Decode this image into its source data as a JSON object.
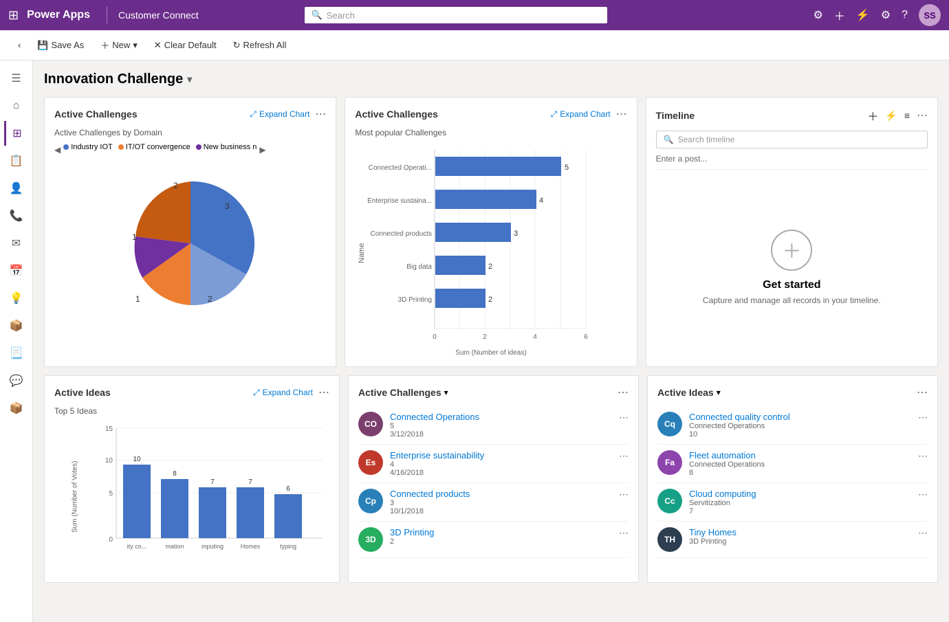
{
  "topNav": {
    "brand": "Power Apps",
    "divider": "|",
    "appName": "Customer Connect",
    "searchPlaceholder": "Search",
    "avatar": "SS"
  },
  "toolbar": {
    "saveAs": "Save As",
    "new": "New",
    "clearDefault": "Clear Default",
    "refreshAll": "Refresh All"
  },
  "pageTitle": "Innovation Challenge",
  "sidebar": {
    "items": [
      "⊞",
      "⌂",
      "☰",
      "♟",
      "👤",
      "☎",
      "✉",
      "📅",
      "💡",
      "📦",
      "🗂",
      "💬",
      "📦"
    ]
  },
  "topRow": {
    "activeChallengesChart1": {
      "title": "Active Challenges",
      "expandLabel": "Expand Chart",
      "chartSubtitle": "Active Challenges by Domain",
      "legend": [
        {
          "label": "Industry IOT",
          "color": "#4472c4"
        },
        {
          "label": "IT/OT convergence",
          "color": "#ed7d31"
        },
        {
          "label": "New business n",
          "color": "#7030a0"
        }
      ],
      "pieData": [
        {
          "label": "1",
          "value": 1,
          "color": "#ed7d31"
        },
        {
          "label": "2",
          "value": 2,
          "color": "#4472c4"
        },
        {
          "label": "3",
          "value": 3,
          "color": "#4472c4"
        },
        {
          "label": "1",
          "value": 1,
          "color": "#7030a0"
        },
        {
          "label": "2",
          "value": 2,
          "color": "#c55a11"
        }
      ]
    },
    "activeChallengesChart2": {
      "title": "Active Challenges",
      "expandLabel": "Expand Chart",
      "chartSubtitle": "Most popular Challenges",
      "yAxisLabel": "Name",
      "xAxisLabel": "Sum (Number of ideas)",
      "bars": [
        {
          "label": "Connected Operati...",
          "value": 5
        },
        {
          "label": "Enterprise sustaina...",
          "value": 4
        },
        {
          "label": "Connected products",
          "value": 3
        },
        {
          "label": "Big data",
          "value": 2
        },
        {
          "label": "3D Printing",
          "value": 2
        }
      ],
      "xMax": 6
    },
    "timeline": {
      "title": "Timeline",
      "searchPlaceholder": "Search timeline",
      "enterPost": "Enter a post...",
      "getStarted": "Get started",
      "getStartedSub": "Capture and manage all records in your timeline."
    }
  },
  "bottomRow": {
    "activeIdeasChart": {
      "title": "Active Ideas",
      "expandLabel": "Expand Chart",
      "chartSubtitle": "Top 5 Ideas",
      "yAxisLabel": "Sum (Number of Votes)",
      "bars": [
        {
          "label": "ity co...",
          "value": 10
        },
        {
          "label": "mation",
          "value": 8
        },
        {
          "label": "mputing",
          "value": 7
        },
        {
          "label": "Homes",
          "value": 7
        },
        {
          "label": "typing",
          "value": 6
        }
      ],
      "yMax": 15
    },
    "activeChallengesList": {
      "title": "Active Challenges",
      "items": [
        {
          "initials": "CO",
          "color": "#7b3f6e",
          "name": "Connected Operations",
          "count": 5,
          "date": "3/12/2018"
        },
        {
          "initials": "Es",
          "color": "#c0392b",
          "name": "Enterprise sustainability",
          "count": 4,
          "date": "4/16/2018"
        },
        {
          "initials": "Cp",
          "color": "#2980b9",
          "name": "Connected products",
          "count": 3,
          "date": "10/1/2018"
        },
        {
          "initials": "3D",
          "color": "#27ae60",
          "name": "3D Printing",
          "count": 2,
          "date": ""
        }
      ]
    },
    "activeIdeasList": {
      "title": "Active Ideas",
      "items": [
        {
          "initials": "Cq",
          "color": "#2980b9",
          "name": "Connected quality control",
          "sub": "Connected Operations",
          "count": 10
        },
        {
          "initials": "Fa",
          "color": "#8e44ad",
          "name": "Fleet automation",
          "sub": "Connected Operations",
          "count": 8
        },
        {
          "initials": "Cc",
          "color": "#16a085",
          "name": "Cloud computing",
          "sub": "Servitization",
          "count": 7
        },
        {
          "initials": "TH",
          "color": "#2c3e50",
          "name": "Tiny Homes",
          "sub": "3D Printing",
          "count": ""
        }
      ]
    }
  }
}
